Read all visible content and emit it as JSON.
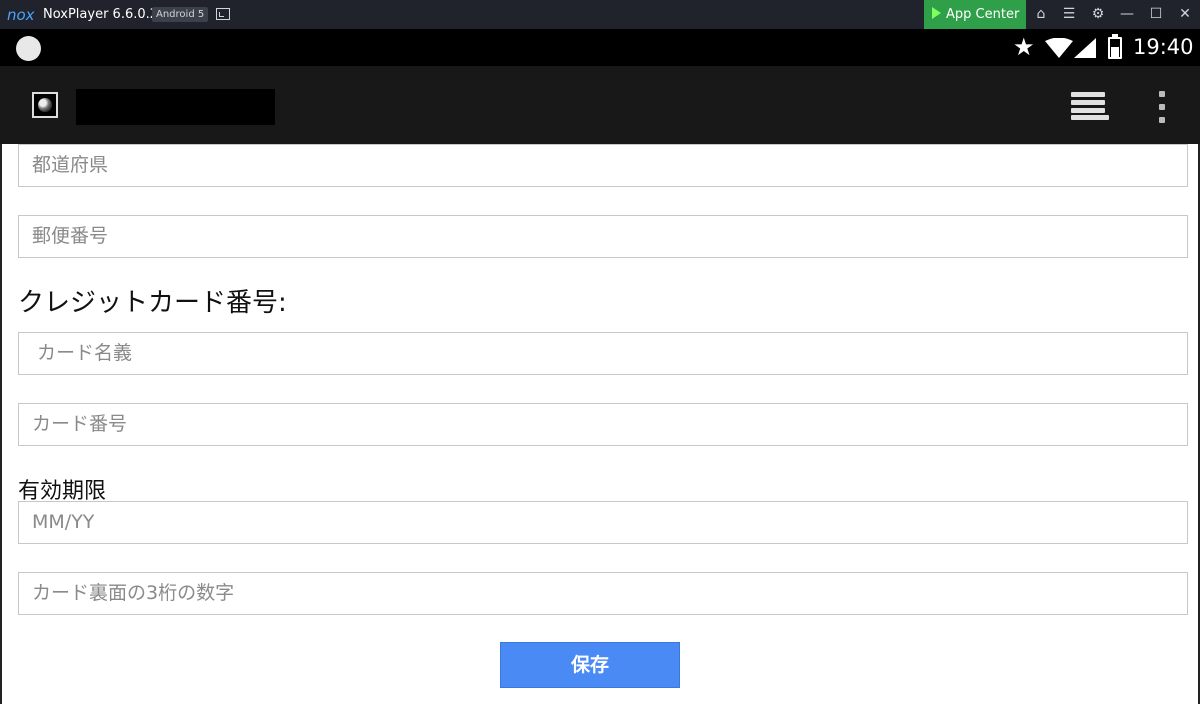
{
  "emulator": {
    "logo": "nox",
    "title": "NoxPlayer 6.6.0.2",
    "android_badge": "Android 5",
    "app_center_label": "App Center",
    "accent": "#2fa049"
  },
  "statusbar": {
    "time": "19:40",
    "icons": [
      "star-icon",
      "wifi-icon",
      "signal-icon",
      "battery-icon"
    ]
  },
  "actionbar": {
    "icons": [
      "globe-icon",
      "menu-stack-icon",
      "overflow-menu-icon"
    ]
  },
  "form": {
    "prefecture_placeholder": "都道府県",
    "postal_code_placeholder": "郵便番号",
    "credit_card_heading": "クレジットカード番号:",
    "card_name_placeholder": "カード名義",
    "card_number_placeholder": "カード番号",
    "expiry_heading": "有効期限",
    "expiry_placeholder": "MM/YY",
    "cvv_placeholder": "カード裏面の3桁の数字",
    "save_label": "保存",
    "save_color": "#4a8af4"
  }
}
